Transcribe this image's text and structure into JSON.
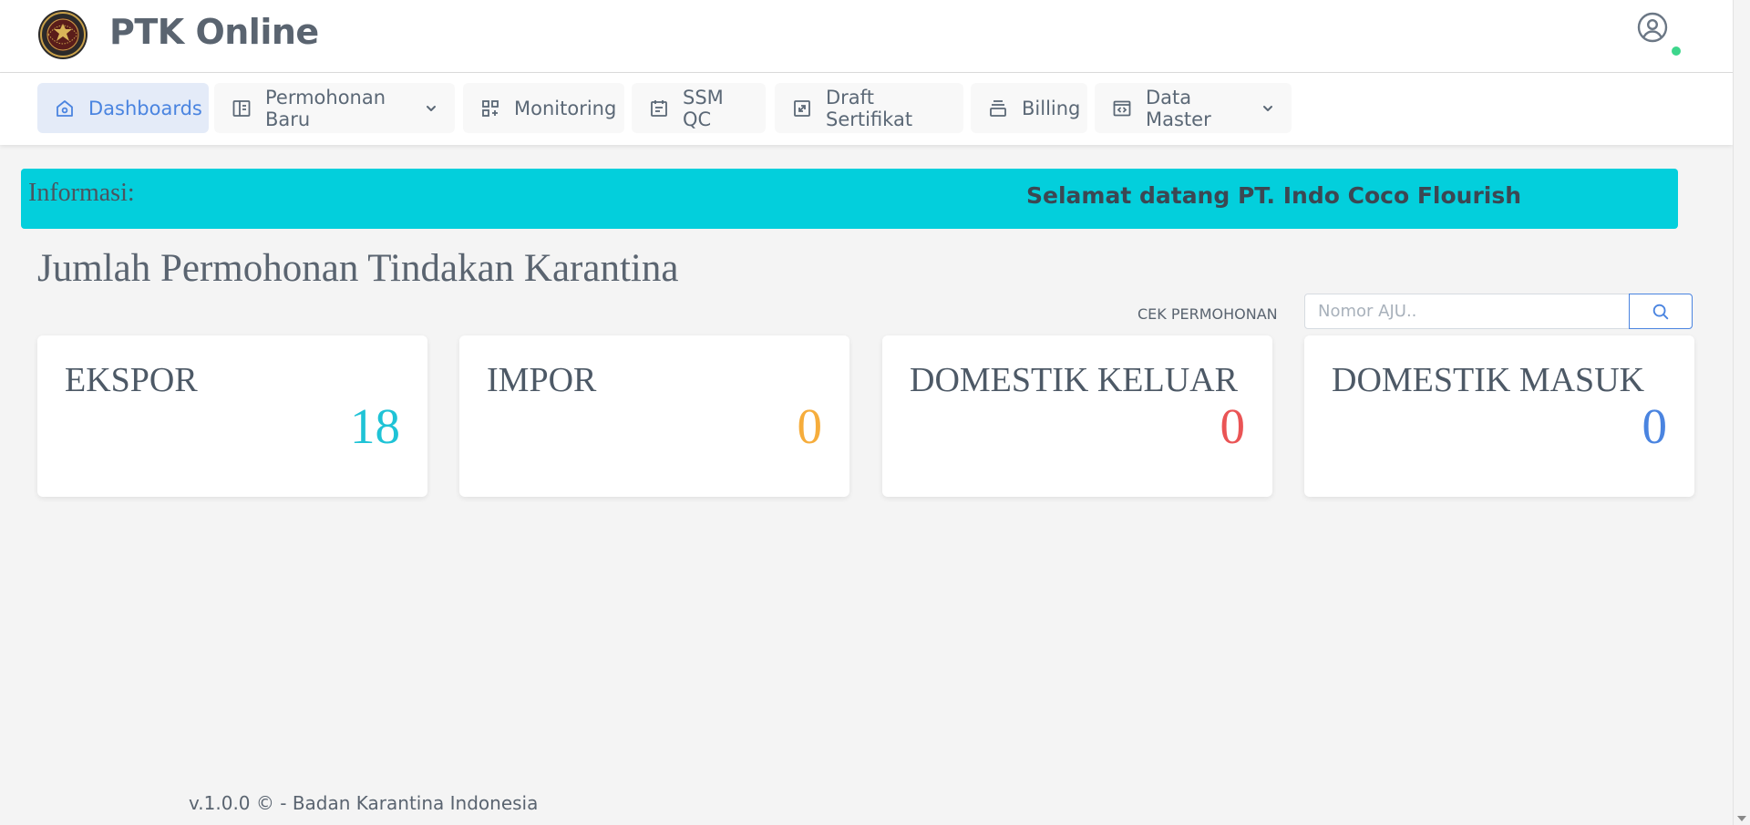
{
  "header": {
    "app_title": "PTK Online",
    "logo_icon": "quarantine-agency-emblem",
    "user_icon": "user-circle-icon",
    "status_color": "#3dd68c"
  },
  "nav": {
    "items": [
      {
        "label": "Dashboards",
        "icon": "home-icon",
        "active": true
      },
      {
        "label": "Permohonan Baru",
        "icon": "layout-icon",
        "dropdown": true
      },
      {
        "label": "Monitoring",
        "icon": "grid-plus-icon"
      },
      {
        "label": "SSM QC",
        "icon": "calendar-icon"
      },
      {
        "label": "Draft Sertifikat",
        "icon": "resize-icon"
      },
      {
        "label": "Billing",
        "icon": "stack-icon"
      },
      {
        "label": "Data Master",
        "icon": "code-window-icon",
        "dropdown": true
      }
    ],
    "accent_color": "#4a84e0"
  },
  "info": {
    "label": "Informasi:",
    "message": "Selamat datang PT. Indo Coco Flourish",
    "background": "#03cfdc"
  },
  "main": {
    "title": "Jumlah Permohonan Tindakan Karantina",
    "search": {
      "label": "CEK PERMOHONAN",
      "placeholder": "Nomor AJU..",
      "button_icon": "search-icon"
    },
    "stats": [
      {
        "label": "EKSPOR",
        "value": "18",
        "color": "#1fc3d6"
      },
      {
        "label": "IMPOR",
        "value": "0",
        "color": "#f6ad3c"
      },
      {
        "label": "DOMESTIK KELUAR",
        "value": "0",
        "color": "#ea5455"
      },
      {
        "label": "DOMESTIK MASUK",
        "value": "0",
        "color": "#4a84e0"
      }
    ]
  },
  "footer": {
    "text": "v.1.0.0 © - Badan Karantina Indonesia"
  }
}
